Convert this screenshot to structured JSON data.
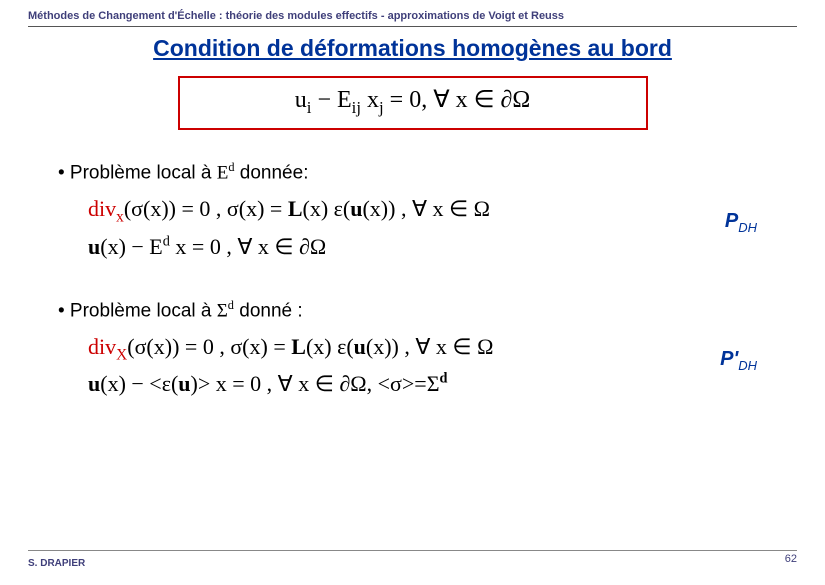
{
  "header": "Méthodes de Changement d'Échelle : théorie des modules effectifs - approximations de Voigt et Reuss",
  "title": "Condition de déformations homogènes au bord",
  "boxed_equation": {
    "lhs": "u",
    "lhs_sub": "i",
    "minus": " − E",
    "e_sub": "ij",
    "x": " x",
    "x_sub": "j",
    "eq": " = 0,  ∀ x ∈ ∂Ω"
  },
  "bullet1_pre": "• Problème local à ",
  "bullet1_sym": "E",
  "bullet1_sup": "d",
  "bullet1_post": " donnée:",
  "eq1_line1_a": "div",
  "eq1_line1_a2": "x",
  "eq1_line1_b": "(σ(x)) = 0 ,  σ(x) = ",
  "eq1_line1_L": "L",
  "eq1_line1_c": "(x) ε(",
  "eq1_line1_u": "u",
  "eq1_line1_d": "(x)) ,  ∀ x ∈ Ω",
  "eq1_line2_u": "u",
  "eq1_line2_a": "(x) − E",
  "eq1_line2_sup": "d",
  "eq1_line2_b": " x = 0 ,  ∀ x ∈ ∂Ω",
  "label1_p": "P",
  "label1_sub": "DH",
  "bullet2_pre": "• Problème local à ",
  "bullet2_sym": "Σ",
  "bullet2_sup": "d",
  "bullet2_post": " donné :",
  "eq2_line1_a": "div",
  "eq2_line1_a2": "X",
  "eq2_line1_b": "(σ(x)) = 0 ,  σ(x) = ",
  "eq2_line1_L": "L",
  "eq2_line1_c": "(x) ε(",
  "eq2_line1_u": "u",
  "eq2_line1_d": "(x)) ,  ∀ x ∈ Ω",
  "eq2_line2_u": "u",
  "eq2_line2_a": "(x) − <ε(",
  "eq2_line2_u2": "u",
  "eq2_line2_b": ")> x = 0 ,  ∀ x ∈ ∂Ω,                 <σ>=Σ",
  "eq2_line2_sup": "d",
  "label2_p": "P'",
  "label2_sub": "DH",
  "footer_left": "S. DRAPIER",
  "footer_right": "62"
}
